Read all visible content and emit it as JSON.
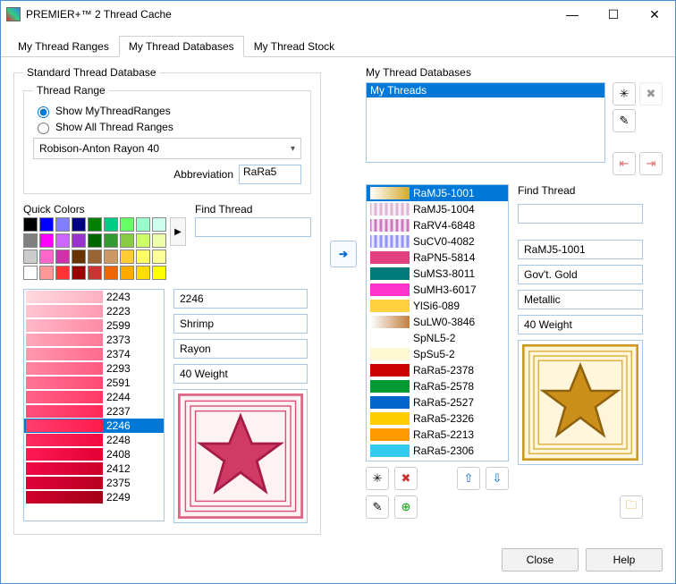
{
  "window": {
    "title": "PREMIER+™ 2 Thread Cache"
  },
  "titlebar": {
    "min": "—",
    "max": "☐",
    "close": "✕"
  },
  "tabs": [
    {
      "label": "My Thread Ranges",
      "active": false
    },
    {
      "label": "My Thread Databases",
      "active": true
    },
    {
      "label": "My Thread Stock",
      "active": false
    }
  ],
  "left": {
    "groupTitle": "Standard Thread Database",
    "rangeTitle": "Thread Range",
    "radioMy": "Show MyThreadRanges",
    "radioAll": "Show All Thread Ranges",
    "rangeSelected": "Robison-Anton Rayon 40",
    "abbrevLabel": "Abbreviation",
    "abbrevValue": "RaRa5",
    "quickColorsLabel": "Quick Colors",
    "findThreadLabel": "Find Thread",
    "findThreadValue": "",
    "swatches": [
      "#000000",
      "#0000ff",
      "#8080ff",
      "#000080",
      "#008000",
      "#00cc88",
      "#66ff66",
      "#99ffcc",
      "#ccffee",
      "#808080",
      "#ff00ff",
      "#cc66ff",
      "#9933cc",
      "#006600",
      "#339933",
      "#88cc44",
      "#ccff66",
      "#eeffaa",
      "#cccccc",
      "#ff66cc",
      "#cc33aa",
      "#663300",
      "#996633",
      "#cc9966",
      "#ffcc33",
      "#ffff66",
      "#ffff99",
      "#ffffff",
      "#ff9999",
      "#ff3333",
      "#990000",
      "#cc3333",
      "#ee6600",
      "#ffaa00",
      "#ffdd00",
      "#ffff00"
    ],
    "threads": [
      {
        "n": "2243",
        "c1": "#ffd9e0",
        "c2": "#ffb0c2"
      },
      {
        "n": "2223",
        "c1": "#ffc4d2",
        "c2": "#ff9ab3"
      },
      {
        "n": "2599",
        "c1": "#ffb8c9",
        "c2": "#ff8aa6"
      },
      {
        "n": "2373",
        "c1": "#ffa8bd",
        "c2": "#ff7a99"
      },
      {
        "n": "2374",
        "c1": "#ff98b0",
        "c2": "#ff6a8c"
      },
      {
        "n": "2293",
        "c1": "#ff86a2",
        "c2": "#ff5a80"
      },
      {
        "n": "2591",
        "c1": "#ff7495",
        "c2": "#ff4a73"
      },
      {
        "n": "2244",
        "c1": "#ff6288",
        "c2": "#ff3a66"
      },
      {
        "n": "2237",
        "c1": "#ff507b",
        "c2": "#ff2a59"
      },
      {
        "n": "2246",
        "c1": "#ff3e6e",
        "c2": "#ff1a4c",
        "sel": true
      },
      {
        "n": "2248",
        "c1": "#ff2c61",
        "c2": "#f00a3f"
      },
      {
        "n": "2408",
        "c1": "#ff1a54",
        "c2": "#e00033"
      },
      {
        "n": "2412",
        "c1": "#f00847",
        "c2": "#cc0029"
      },
      {
        "n": "2375",
        "c1": "#e0003a",
        "c2": "#b80020"
      },
      {
        "n": "2249",
        "c1": "#d0002d",
        "c2": "#a40018"
      }
    ],
    "detail": {
      "code": "2246",
      "name": "Shrimp",
      "material": "Rayon",
      "weight": "40 Weight"
    }
  },
  "transferArrow": "➔",
  "right": {
    "title": "My Thread Databases",
    "selectedDb": "My Threads",
    "findThreadLabel": "Find Thread",
    "findThreadValue": "",
    "threads": [
      {
        "code": "RaMJ5-1001",
        "c": "#d4a828",
        "tex": "grad",
        "sel": true
      },
      {
        "code": "RaMJ5-1004",
        "c": "#d9a8d0",
        "tex": "stripe"
      },
      {
        "code": "RaRV4-6848",
        "c": "#c060b0",
        "tex": "stripe"
      },
      {
        "code": "SuCV0-4082",
        "c": "#7f7fff",
        "tex": "stripe"
      },
      {
        "code": "RaPN5-5814",
        "c": "#e04080"
      },
      {
        "code": "SuMS3-8011",
        "c": "#007a7a"
      },
      {
        "code": "SuMH3-6017",
        "c": "#ff33cc"
      },
      {
        "code": "YlSi6-089",
        "c": "#ffd040"
      },
      {
        "code": "SuLW0-3846",
        "c": "#c08040",
        "tex": "grad"
      },
      {
        "code": "SpNL5-2",
        "c": "#ffffff"
      },
      {
        "code": "SpSu5-2",
        "c": "#fff8d0"
      },
      {
        "code": "RaRa5-2378",
        "c": "#cc0000"
      },
      {
        "code": "RaRa5-2578",
        "c": "#009933"
      },
      {
        "code": "RaRa5-2527",
        "c": "#0066cc"
      },
      {
        "code": "RaRa5-2326",
        "c": "#ffcc00"
      },
      {
        "code": "RaRa5-2213",
        "c": "#ff9900"
      },
      {
        "code": "RaRa5-2306",
        "c": "#33ccee"
      }
    ],
    "detail": {
      "code": "RaMJ5-1001",
      "name": "Gov't. Gold",
      "material": "Metallic",
      "weight": "40 Weight"
    }
  },
  "footer": {
    "close": "Close",
    "help": "Help"
  }
}
